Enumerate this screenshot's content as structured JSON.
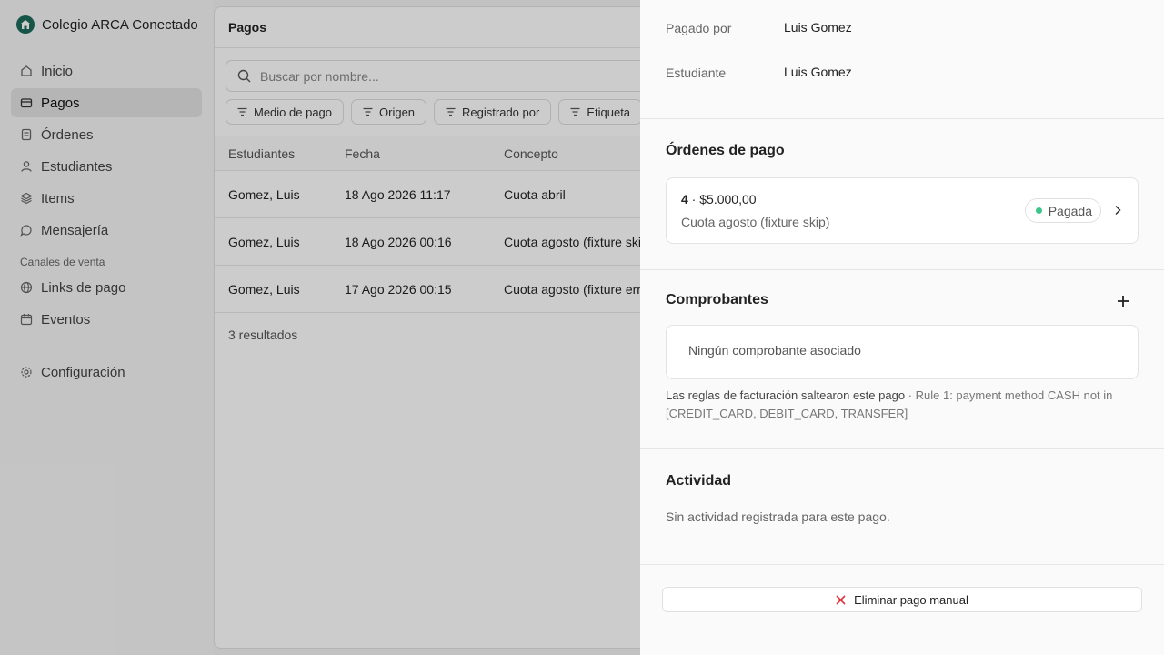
{
  "sidebar": {
    "brand": "Colegio ARCA Conectado",
    "items": [
      {
        "label": "Inicio",
        "icon": "home-icon"
      },
      {
        "label": "Pagos",
        "icon": "wallet-icon",
        "active": true
      },
      {
        "label": "Órdenes",
        "icon": "document-icon"
      },
      {
        "label": "Estudiantes",
        "icon": "user-icon"
      },
      {
        "label": "Items",
        "icon": "layers-icon"
      },
      {
        "label": "Mensajería",
        "icon": "chat-icon"
      }
    ],
    "section_label": "Canales de venta",
    "channel_items": [
      {
        "label": "Links de pago",
        "icon": "link-icon"
      },
      {
        "label": "Eventos",
        "icon": "calendar-icon"
      }
    ],
    "config_label": "Configuración"
  },
  "main": {
    "title": "Pagos",
    "search_placeholder": "Buscar por nombre...",
    "filters": [
      "Medio de pago",
      "Origen",
      "Registrado por",
      "Etiqueta"
    ],
    "columns": [
      "Estudiantes",
      "Fecha",
      "Concepto"
    ],
    "rows": [
      {
        "student": "Gomez, Luis",
        "date": "18 Ago 2026 11:17",
        "concept": "Cuota abril"
      },
      {
        "student": "Gomez, Luis",
        "date": "18 Ago 2026 00:16",
        "concept": "Cuota agosto (fixture skip)"
      },
      {
        "student": "Gomez, Luis",
        "date": "17 Ago 2026 00:15",
        "concept": "Cuota agosto (fixture error)"
      }
    ],
    "results": "3 resultados"
  },
  "drawer": {
    "paid_by_label": "Pagado por",
    "paid_by_value": "Luis Gomez",
    "student_label": "Estudiante",
    "student_value": "Luis Gomez",
    "orders_title": "Órdenes de pago",
    "order": {
      "number": "4",
      "separator": " · ",
      "amount": "$5.000,00",
      "concept": "Cuota agosto (fixture skip)",
      "status": "Pagada",
      "status_color": "#3cc48b"
    },
    "receipts_title": "Comprobantes",
    "no_receipt": "Ningún comprobante asociado",
    "billing_note_strong": "Las reglas de facturación saltearon este pago",
    "billing_note_detail": " · Rule 1: payment method CASH not in [CREDIT_CARD, DEBIT_CARD, TRANSFER]",
    "activity_title": "Actividad",
    "no_activity": "Sin actividad registrada para este pago.",
    "delete_label": "Eliminar pago manual",
    "delete_color": "#e0323a"
  }
}
